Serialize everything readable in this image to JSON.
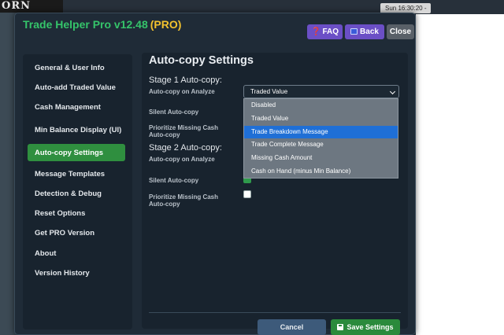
{
  "background": {
    "logo_text": "ORN",
    "clock": "Sun 16:30:20 -"
  },
  "modal": {
    "title": "Trade Helper Pro v12.48",
    "title_badge": "(PRO)",
    "buttons": {
      "faq": "FAQ",
      "back": "Back",
      "close": "Close"
    }
  },
  "sidebar": {
    "items": [
      {
        "label": "General & User Info"
      },
      {
        "label": "Auto-add Traded Value"
      },
      {
        "label": "Cash Management"
      },
      {
        "label": "Min Balance Display (UI)"
      },
      {
        "label": "Auto-copy Settings",
        "active": true
      },
      {
        "label": "Message Templates"
      },
      {
        "label": "Detection & Debug"
      },
      {
        "label": "Reset Options"
      },
      {
        "label": "Get PRO Version"
      },
      {
        "label": "About"
      },
      {
        "label": "Version History"
      }
    ]
  },
  "content": {
    "title": "Auto-copy Settings",
    "stage1": {
      "title": "Stage 1 Auto-copy:",
      "analyze_label": "Auto-copy on Analyze",
      "analyze_value": "Traded Value",
      "silent_label": "Silent Auto-copy",
      "prioritize_label": "Prioritize Missing Cash Auto-copy"
    },
    "stage2": {
      "title": "Stage 2 Auto-copy:",
      "analyze_label": "Auto-copy on Analyze",
      "silent_label": "Silent Auto-copy",
      "silent_checked": true,
      "prioritize_label": "Prioritize Missing Cash Auto-copy",
      "prioritize_checked": false
    },
    "dropdown_options": [
      "Disabled",
      "Traded Value",
      "Trade Breakdown Message",
      "Trade Complete Message",
      "Missing Cash Amount",
      "Cash on Hand (minus Min Balance)"
    ],
    "dropdown_highlighted": "Trade Breakdown Message",
    "cancel_label": "Cancel",
    "save_label": "Save Settings"
  },
  "colors": {
    "accent_green": "#2f8f3f",
    "title_green": "#35c46a",
    "pro_yellow": "#f2c22e",
    "header_purple": "#6b4fc6",
    "highlight_blue": "#1f6fd6"
  }
}
